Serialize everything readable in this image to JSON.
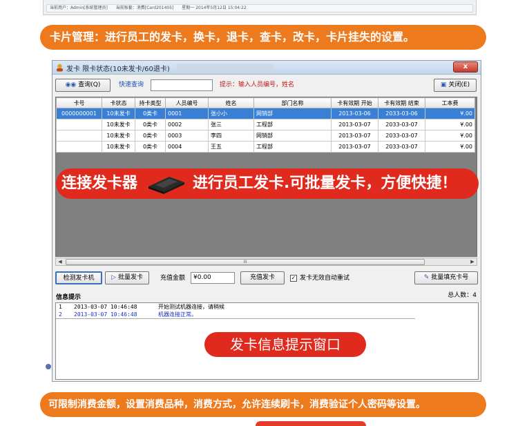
{
  "status_strip": {
    "user": "当前用户：Admin[系统管理员]",
    "account": "当前账套：消费[Card201405]",
    "date": "星期一  2014年5月12日 15:04:22"
  },
  "banners": {
    "top": "卡片管理：进行员工的发卡，换卡，退卡，查卡，改卡，卡片挂失的设置。",
    "bottom": "可限制消费金额，设置消费品种，消费方式，允许连续刷卡，消费验证个人密码等设置。"
  },
  "window": {
    "title": "发卡 限卡状态(10未发卡/60退卡)",
    "close": "x",
    "toolbar": {
      "query_label": "查询(Q)",
      "quick_query_label": "快速查询",
      "search_value": "",
      "hint": "提示：输入人员编号，姓名",
      "close_label": "关闭(E)"
    },
    "table": {
      "columns": [
        "卡号",
        "卡状态",
        "持卡类型",
        "人员编号",
        "姓名",
        "部门名称",
        "卡有效期 开始",
        "卡有效期 结束",
        "工本费"
      ],
      "rows": [
        [
          "0000000001",
          "10未发卡",
          "0类卡",
          "0001",
          "张小小",
          "网销部",
          "2013-03-06",
          "2033-03-06",
          "¥.00"
        ],
        [
          "",
          "10未发卡",
          "0类卡",
          "0002",
          "张三",
          "工程部",
          "2013-03-07",
          "2033-03-07",
          "¥.00"
        ],
        [
          "",
          "10未发卡",
          "0类卡",
          "0003",
          "李四",
          "网销部",
          "2013-03-07",
          "2033-03-07",
          "¥.00"
        ],
        [
          "",
          "10未发卡",
          "0类卡",
          "0004",
          "王五",
          "工程部",
          "2013-03-07",
          "2033-03-07",
          "¥.00"
        ]
      ],
      "selected_row": 0,
      "scroll_grip": "III"
    },
    "overlay": {
      "left_text": "连接发卡器",
      "right_text": "进行员工发卡.可批量发卡，方便快捷！"
    },
    "controls": {
      "detect_label": "检测发卡机",
      "batch_issue_label": "批量发卡",
      "amount_label": "充值金额",
      "amount_value": "¥0.00",
      "recharge_label": "充值发卡",
      "auto_retry_label": "发卡无效自动重试",
      "auto_retry_checked": true,
      "batch_fill_label": "批量填充卡号"
    },
    "info": {
      "title": "信息提示",
      "total": "总人数：4",
      "logs": [
        {
          "n": "1",
          "time": "2013-03-07 10:46:48",
          "msg": "开始测试机器连接，请稍候"
        },
        {
          "n": "2",
          "time": "2013-03-07 10:46:48",
          "msg": "机器连接正常。"
        }
      ],
      "callout": "发卡信息提示窗口"
    }
  },
  "colors": {
    "orange": "#ee7a1e",
    "red": "#e12a1e",
    "select_blue": "#3a7fd6"
  }
}
